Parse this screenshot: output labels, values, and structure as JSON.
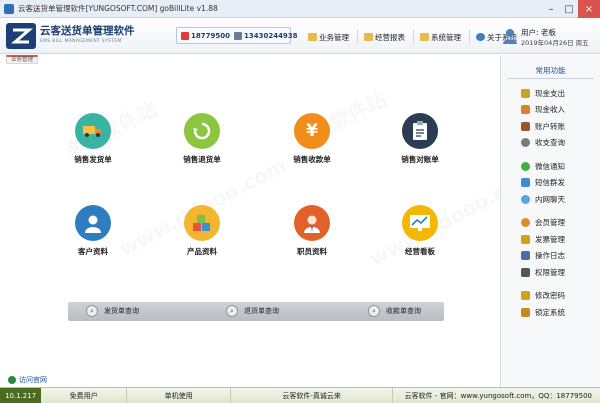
{
  "window": {
    "title": "云客送货单管理软件[YUNGOSOFT.COM]  goBillLite v1.88",
    "controls": [
      "minimize",
      "maximize",
      "close"
    ]
  },
  "brand": {
    "name_cn": "云客送货单管理软件",
    "name_en": "EMS BILL MANAGEMENT SYSTEM",
    "color": "#1d3f73"
  },
  "contacts": [
    {
      "number": "18779500",
      "icon": "qq-icon"
    },
    {
      "number": "13430244938",
      "icon": "phone-icon"
    }
  ],
  "nav": [
    {
      "label": "业务管理",
      "icon": "folder-icon"
    },
    {
      "label": "经营报表",
      "icon": "folder-icon"
    },
    {
      "label": "系统管理",
      "icon": "folder-icon"
    },
    {
      "label": "关于系统",
      "icon": "help-icon"
    }
  ],
  "user": {
    "name": "用户: 老板",
    "date": "2019年04月26日 周五"
  },
  "tab": {
    "label": "业务管理"
  },
  "functions": [
    {
      "label": "销售发货单",
      "color": "#3bb3a2",
      "icon": "truck-icon"
    },
    {
      "label": "销售退货单",
      "color": "#8cc63f",
      "icon": "return-icon"
    },
    {
      "label": "销售收款单",
      "color": "#f28c1b",
      "icon": "yuan-icon",
      "glyph": "¥"
    },
    {
      "label": "销售对账单",
      "color": "#2b3d52",
      "icon": "clipboard-icon"
    },
    {
      "label": "客户资料",
      "color": "#2f7dc1",
      "icon": "customer-icon"
    },
    {
      "label": "产品资料",
      "color": "#f2b72e",
      "icon": "product-icon"
    },
    {
      "label": "职员资料",
      "color": "#e2612a",
      "icon": "staff-icon"
    },
    {
      "label": "经营看板",
      "color": "#f5b800",
      "icon": "dashboard-icon"
    }
  ],
  "queries": [
    {
      "label": "发货单查询"
    },
    {
      "label": "退货单查询"
    },
    {
      "label": "收款单查询"
    }
  ],
  "visit_site": {
    "label": "访问官网"
  },
  "sidebar": {
    "title": "常用功能",
    "groups": [
      [
        {
          "label": "现金支出",
          "icon": "cash-out-icon",
          "color": "#c9a227"
        },
        {
          "label": "现金收入",
          "icon": "cash-in-icon",
          "color": "#d9842b"
        },
        {
          "label": "账户转账",
          "icon": "transfer-icon",
          "color": "#a0522d"
        },
        {
          "label": "收支查询",
          "icon": "search-icon",
          "color": "#7a7a7a"
        }
      ],
      [
        {
          "label": "微信通知",
          "icon": "wechat-icon",
          "color": "#3fae3f"
        },
        {
          "label": "短信群发",
          "icon": "sms-icon",
          "color": "#3c8dcf"
        },
        {
          "label": "内网聊天",
          "icon": "chat-icon",
          "color": "#55a7e0"
        }
      ],
      [
        {
          "label": "会员管理",
          "icon": "member-icon",
          "color": "#e0892e"
        },
        {
          "label": "发票管理",
          "icon": "invoice-icon",
          "color": "#d4a017"
        },
        {
          "label": "操作日志",
          "icon": "log-icon",
          "color": "#4a6fa5"
        },
        {
          "label": "权限管理",
          "icon": "permission-icon",
          "color": "#555555"
        }
      ],
      [
        {
          "label": "修改密码",
          "icon": "key-icon",
          "color": "#d4a017"
        },
        {
          "label": "锁定系统",
          "icon": "lock-icon",
          "color": "#c68a1e"
        }
      ]
    ]
  },
  "statusbar": {
    "version": "10.1.217",
    "user_type": "免费用户",
    "mode": "单机使用",
    "slogan": "云客软件-真诚云来",
    "footer": "云客软件 - 官网：www.yungosoft.com，QQ：18779500"
  },
  "watermarks": [
    "多多软件站",
    "www.ddooo.com"
  ]
}
